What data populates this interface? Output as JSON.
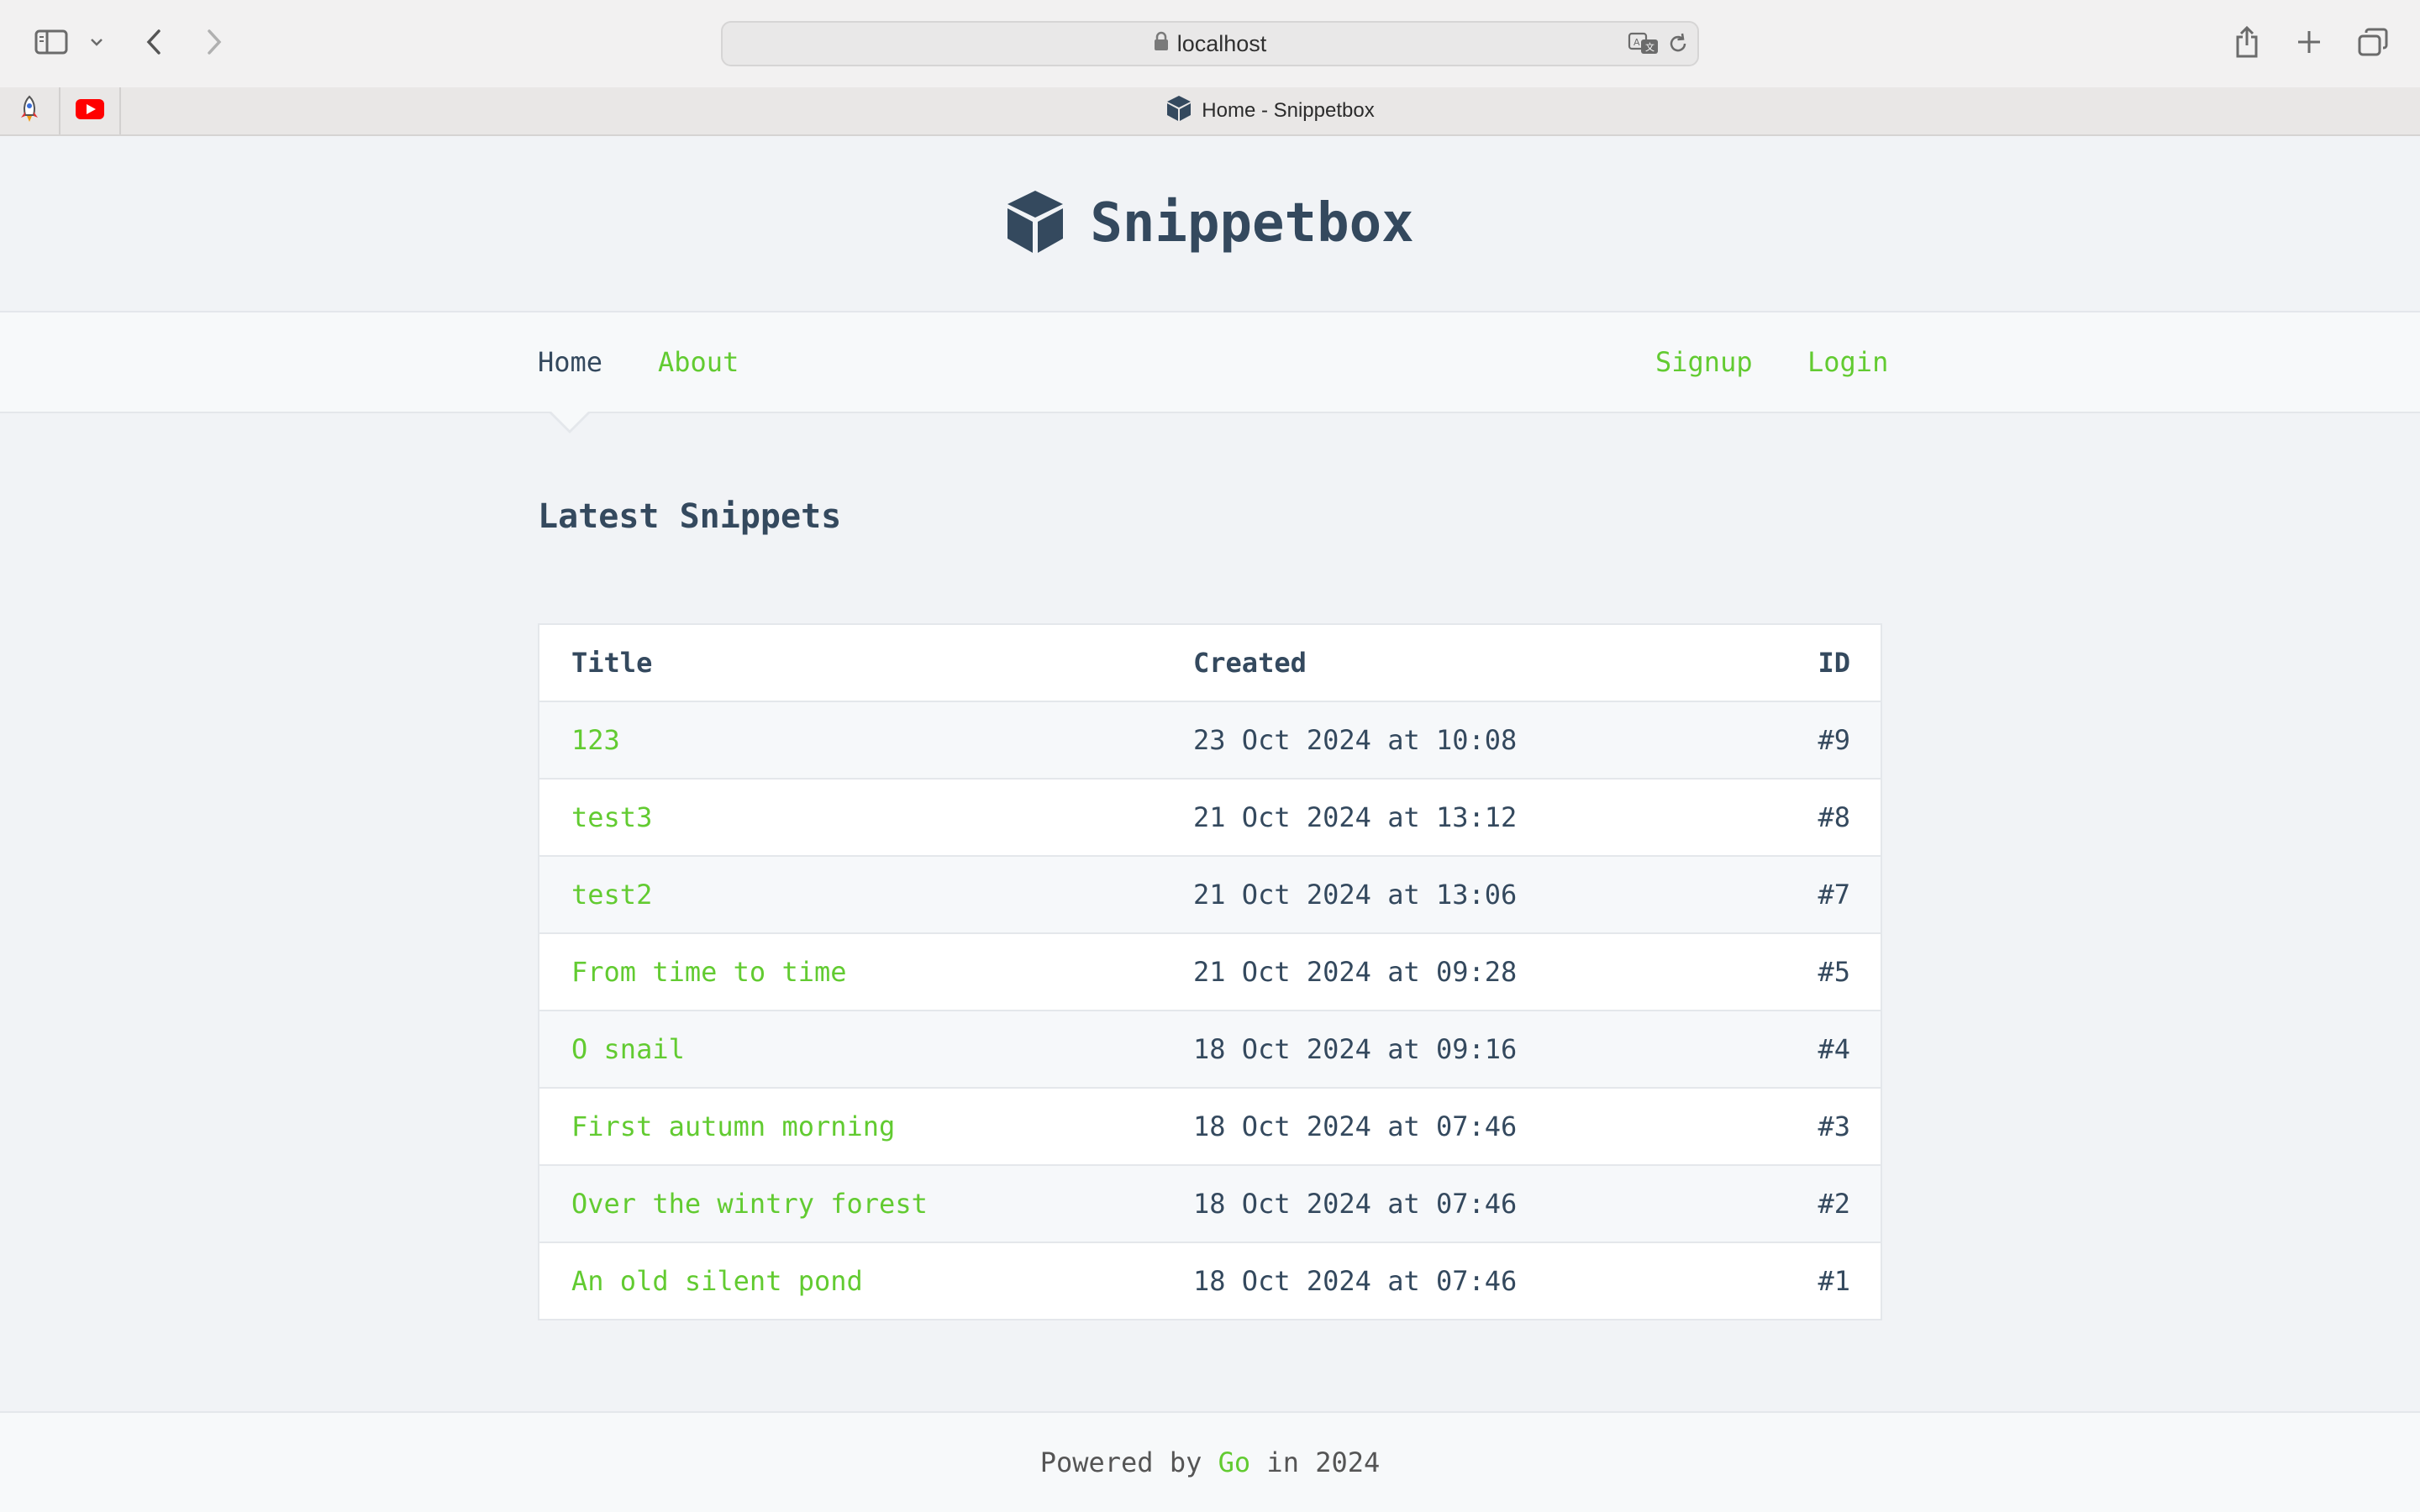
{
  "browser": {
    "url": "localhost",
    "tab_title": "Home - Snippetbox",
    "icons": [
      "sidebar-icon",
      "chevron-down-icon",
      "back-icon",
      "forward-icon",
      "lock-icon",
      "translate-icon",
      "reload-icon",
      "share-icon",
      "new-tab-icon",
      "tab-overview-icon",
      "rocket-icon",
      "youtube-icon",
      "cube-icon"
    ]
  },
  "site": {
    "title": "Snippetbox",
    "logo_icon": "cube-icon",
    "accent_color": "#62cb31",
    "text_color": "#34495e"
  },
  "nav": {
    "home": "Home",
    "about": "About",
    "signup": "Signup",
    "login": "Login"
  },
  "main": {
    "heading": "Latest Snippets",
    "table": {
      "headers": {
        "title": "Title",
        "created": "Created",
        "id": "ID"
      },
      "rows": [
        {
          "title": "123",
          "created": "23 Oct 2024 at 10:08",
          "id": "#9"
        },
        {
          "title": "test3",
          "created": "21 Oct 2024 at 13:12",
          "id": "#8"
        },
        {
          "title": "test2",
          "created": "21 Oct 2024 at 13:06",
          "id": "#7"
        },
        {
          "title": "From time to time",
          "created": "21 Oct 2024 at 09:28",
          "id": "#5"
        },
        {
          "title": "O snail",
          "created": "18 Oct 2024 at 09:16",
          "id": "#4"
        },
        {
          "title": "First autumn morning",
          "created": "18 Oct 2024 at 07:46",
          "id": "#3"
        },
        {
          "title": "Over the wintry forest",
          "created": "18 Oct 2024 at 07:46",
          "id": "#2"
        },
        {
          "title": "An old silent pond",
          "created": "18 Oct 2024 at 07:46",
          "id": "#1"
        }
      ]
    }
  },
  "footer": {
    "prefix": "Powered by ",
    "link": "Go",
    "suffix": " in 2024"
  }
}
